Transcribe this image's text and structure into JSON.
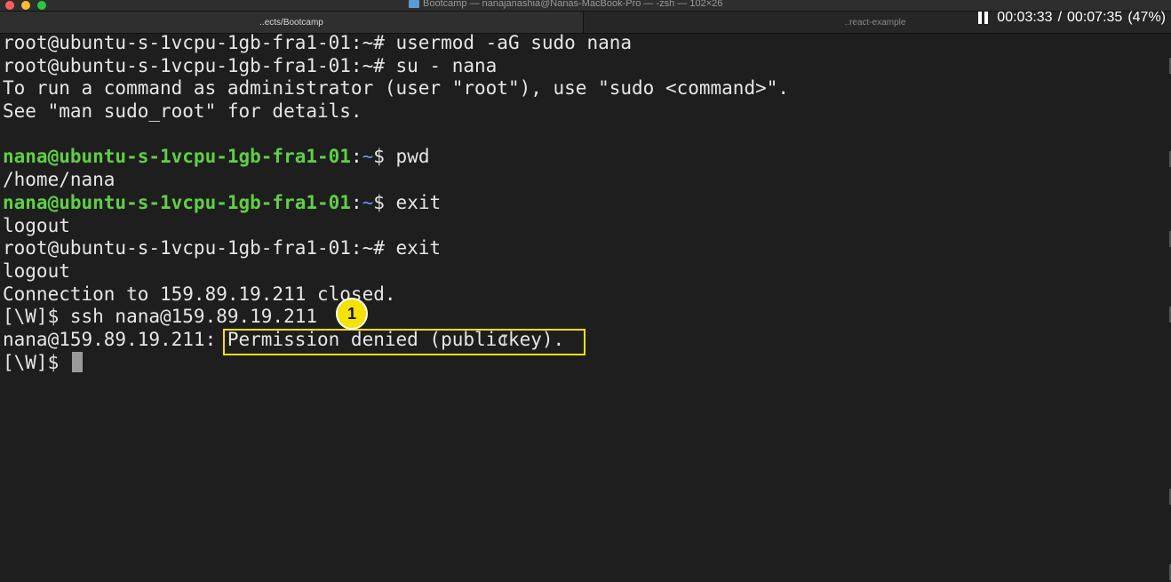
{
  "window": {
    "title": "Bootcamp — nanajanashia@Nanas-MacBook-Pro — -zsh — 102×26",
    "traffic_lights": {
      "close": "#ff5f57",
      "minimize": "#febc2e",
      "zoom": "#28c840"
    }
  },
  "tabs": [
    {
      "label": "..ects/Bootcamp",
      "active": true
    },
    {
      "label": "..react-example",
      "active": false
    }
  ],
  "video": {
    "state": "paused",
    "current_time": "00:03:33",
    "separator": "/",
    "total_time": "00:07:35",
    "progress": "(47%)"
  },
  "terminal": {
    "lines": [
      "root@ubuntu-s-1vcpu-1gb-fra1-01:~# usermod -aG sudo nana",
      "root@ubuntu-s-1vcpu-1gb-fra1-01:~# su - nana",
      "To run a command as administrator (user \"root\"), use \"sudo <command>\".",
      "See \"man sudo_root\" for details.",
      "",
      {
        "user": "nana@ubuntu-s-1vcpu-1gb-fra1-01",
        "sep": ":",
        "path": "~",
        "prompt": "$ ",
        "cmd": "pwd"
      },
      "/home/nana",
      {
        "user": "nana@ubuntu-s-1vcpu-1gb-fra1-01",
        "sep": ":",
        "path": "~",
        "prompt": "$ ",
        "cmd": "exit"
      },
      "logout",
      "root@ubuntu-s-1vcpu-1gb-fra1-01:~# exit",
      "logout",
      "Connection to 159.89.19.211 closed.",
      "[\\W]$ ssh nana@159.89.19.211",
      "nana@159.89.19.211: Permission denied (publickey).",
      "[\\W]$ "
    ],
    "colors": {
      "user_prompt": "#5ed140",
      "path": "#6f90e8",
      "text": "#e6e6e6",
      "background": "#1e1e1e"
    }
  },
  "annotation": {
    "marker_label": "1",
    "highlighted_text": "Permission denied (publickey).",
    "color": "#f4e300"
  }
}
